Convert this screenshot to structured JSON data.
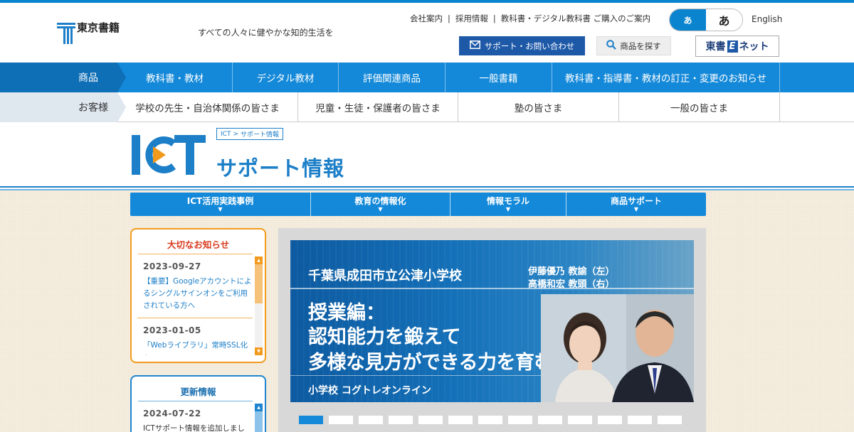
{
  "header": {
    "logo_text": "東京書籍",
    "tagline": "すべての人々に健やかな知的生活を",
    "links": [
      "会社案内",
      "採用情報",
      "教科書・デジタル教科書 ご購入のご案内"
    ],
    "font_small": "あ",
    "font_large": "あ",
    "english": "English",
    "support_label": "サポート・お問い合わせ",
    "search_label": "商品を探す",
    "enet_left": "東書",
    "enet_e": "E",
    "enet_right": "ネット"
  },
  "nav_products": {
    "label": "商品",
    "items": [
      "教科書・教材",
      "デジタル教材",
      "評価関連商品",
      "一般書籍",
      "教科書・指導書・教材の訂正・変更のお知らせ"
    ]
  },
  "nav_customers": {
    "label": "お客様",
    "items": [
      "学校の先生・自治体関係の皆さま",
      "児童・生徒・保護者の皆さま",
      "塾の皆さま",
      "一般の皆さま"
    ]
  },
  "ict": {
    "logo": "ICT",
    "breadcrumb_root": "ICT",
    "breadcrumb_sep": ">",
    "breadcrumb_current": "サポート情報",
    "subtitle": "サポート情報"
  },
  "tabs": [
    "ICT活用実践事例",
    "教育の情報化",
    "情報モラル",
    "商品サポート"
  ],
  "tab_arrow": "▼",
  "notices": {
    "title": "大切なお知らせ",
    "items": [
      {
        "date": "2023-09-27",
        "text": "【重要】Googleアカウントによるシングルサインオンをご利用されている方へ"
      },
      {
        "date": "2023-01-05",
        "text": "「Webライブラリ」常時SSL化へ"
      }
    ]
  },
  "updates": {
    "title": "更新情報",
    "items": [
      {
        "date": "2024-07-22",
        "text": "ICTサポート情報を追加しまし"
      }
    ]
  },
  "slide": {
    "school": "千葉県成田市立公津小学校",
    "teacher1": "伊藤優乃 教諭（左）",
    "teacher2": "高橋和宏 教頭（右）",
    "headline1": "授業編：",
    "headline2": "認知能力を鍛えて",
    "headline3": "多様な見方ができる力を育む",
    "product": "小学校 コグトレオンライン"
  },
  "slider_dots": {
    "count": 13,
    "active_index": 0
  },
  "colors": {
    "brand_blue": "#1489d9",
    "navy": "#1e59a8",
    "notice_orange": "#f39a1d",
    "notice_title_red": "#d93a1f"
  }
}
